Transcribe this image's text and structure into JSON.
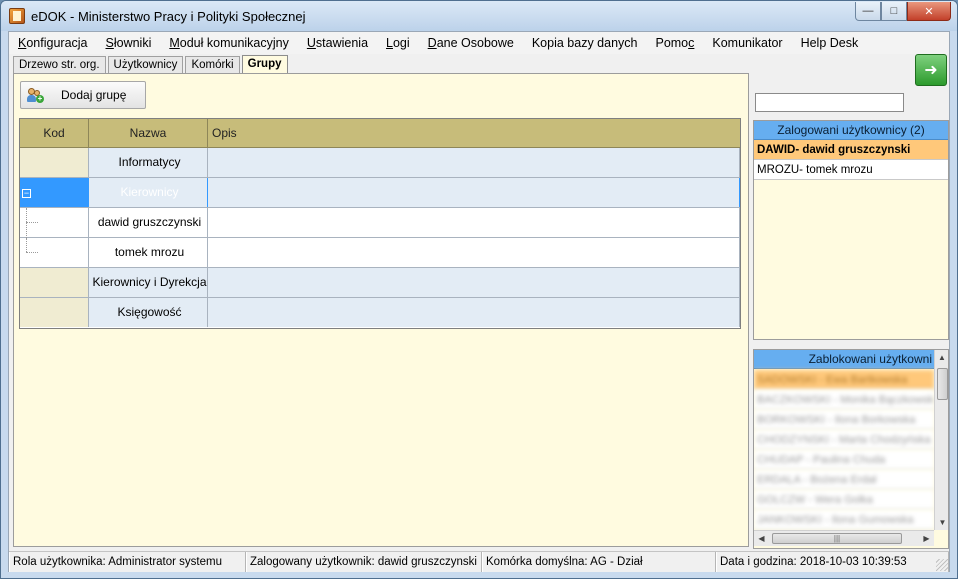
{
  "window": {
    "title": "eDOK - Ministerstwo Pracy i Polityki Społecznej",
    "minimize": "—",
    "maximize": "□",
    "close": "✕"
  },
  "menu": [
    {
      "pre": "",
      "u": "K",
      "post": "onfiguracja"
    },
    {
      "pre": "",
      "u": "S",
      "post": "łowniki"
    },
    {
      "pre": "",
      "u": "M",
      "post": "oduł komunikacyjny"
    },
    {
      "pre": "",
      "u": "U",
      "post": "stawienia"
    },
    {
      "pre": "",
      "u": "L",
      "post": "ogi"
    },
    {
      "pre": "",
      "u": "D",
      "post": "ane Osobowe"
    },
    {
      "pre": "Kopia bazy danych",
      "u": "",
      "post": ""
    },
    {
      "pre": "Pomo",
      "u": "c",
      "post": ""
    },
    {
      "pre": "Komunikator",
      "u": "",
      "post": ""
    },
    {
      "pre": "Help Desk",
      "u": "",
      "post": ""
    }
  ],
  "tabs": [
    "Drzewo str. org.",
    "Użytkownicy",
    "Komórki",
    "Grupy"
  ],
  "toolbar": {
    "add_group_label": "Dodaj grupę"
  },
  "grid": {
    "headers": {
      "kod": "Kod",
      "nazwa": "Nazwa",
      "opis": "Opis"
    },
    "rows": [
      {
        "kod": "",
        "nazwa": "Informatycy",
        "opis": ""
      },
      {
        "kod": "",
        "nazwa": "Kierownicy",
        "opis": ""
      },
      {
        "kod": "",
        "nazwa": "dawid gruszczynski",
        "opis": ""
      },
      {
        "kod": "",
        "nazwa": "tomek mrozu",
        "opis": ""
      },
      {
        "kod": "",
        "nazwa": "Kierownicy i Dyrekcja",
        "opis": ""
      },
      {
        "kod": "",
        "nazwa": "Księgowość",
        "opis": ""
      }
    ],
    "expander": "−"
  },
  "right": {
    "search_value": "",
    "logged_header": "Zalogowani użytkownicy (2)",
    "logged": [
      "DAWID- dawid gruszczynski",
      "MROZU- tomek mrozu"
    ],
    "blocked_header": "Zablokowani użytkowni",
    "blocked": [
      "SADOWSKI - Ewa Bartkowska",
      "BACZKOWSKI - Monika Bączkowska",
      "BORKOWSKI - Ilona Borkowska",
      "CHODZYNSKI - Marta Chodzyńska",
      "CHUDAP - Paulina Chuda",
      "ERDALA - Bożena Erdał",
      "GOLCZW - Wera Golka",
      "JANKOWSKI - Ilona Gumowska"
    ],
    "scroll_up": "▲",
    "scroll_down": "▼",
    "scroll_left": "◀",
    "scroll_right": "▶",
    "hthumb_grip": "|||",
    "exit_icon": "➜"
  },
  "status": {
    "rola": "Rola użytkownika: Administrator systemu",
    "zalogowany": "Zalogowany użytkownik: dawid gruszczynski",
    "komorka": "Komórka domyślna: AG - Dział",
    "data": "Data i godzina: 2018-10-03 10:39:53"
  }
}
